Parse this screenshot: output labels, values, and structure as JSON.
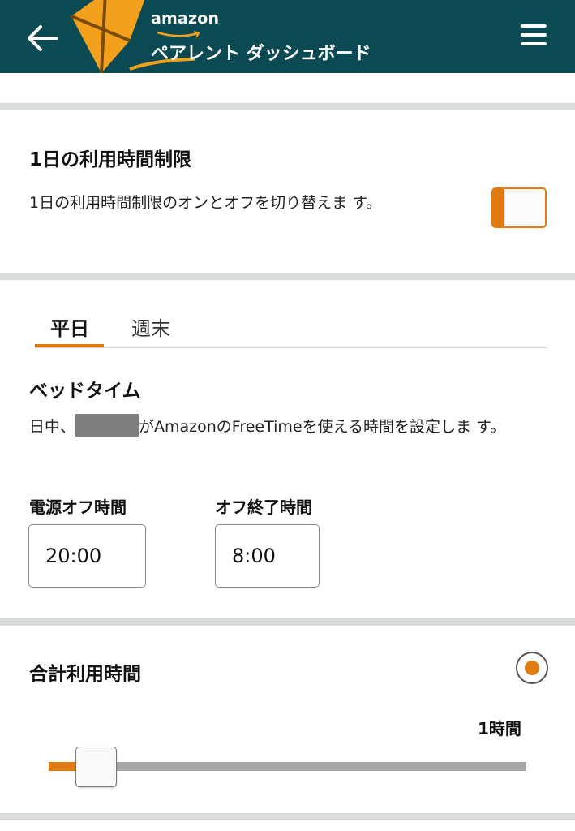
{
  "header": {
    "brand": "amazon",
    "title": "ペアレント ダッシュボード",
    "back_icon": "back-arrow-icon",
    "menu_icon": "hamburger-menu-icon",
    "bg_color": "#0b4a52",
    "kite_color": "#f3a11c"
  },
  "daily_limit": {
    "title": "1日の利用時間制限",
    "description": "1日の利用時間制限のオンとオフを切り替えま す。",
    "toggle_on": true
  },
  "tabs": [
    {
      "label": "平日",
      "active": true
    },
    {
      "label": "週末",
      "active": false
    }
  ],
  "bedtime": {
    "title": "ベッドタイム",
    "desc_before": "日中、",
    "desc_after": "がAmazonのFreeTimeを使える時間を設定しま す。",
    "off_label": "電源オフ時間",
    "off_value": "20:00",
    "end_label": "オフ終了時間",
    "end_value": "8:00"
  },
  "total": {
    "title": "合計利用時間",
    "radio_selected": true,
    "slider_value_label": "1時間",
    "slider_fraction": 0.1
  },
  "colors": {
    "accent": "#e07b12",
    "header_bg": "#0b4a52",
    "divider": "#d8dcda"
  }
}
